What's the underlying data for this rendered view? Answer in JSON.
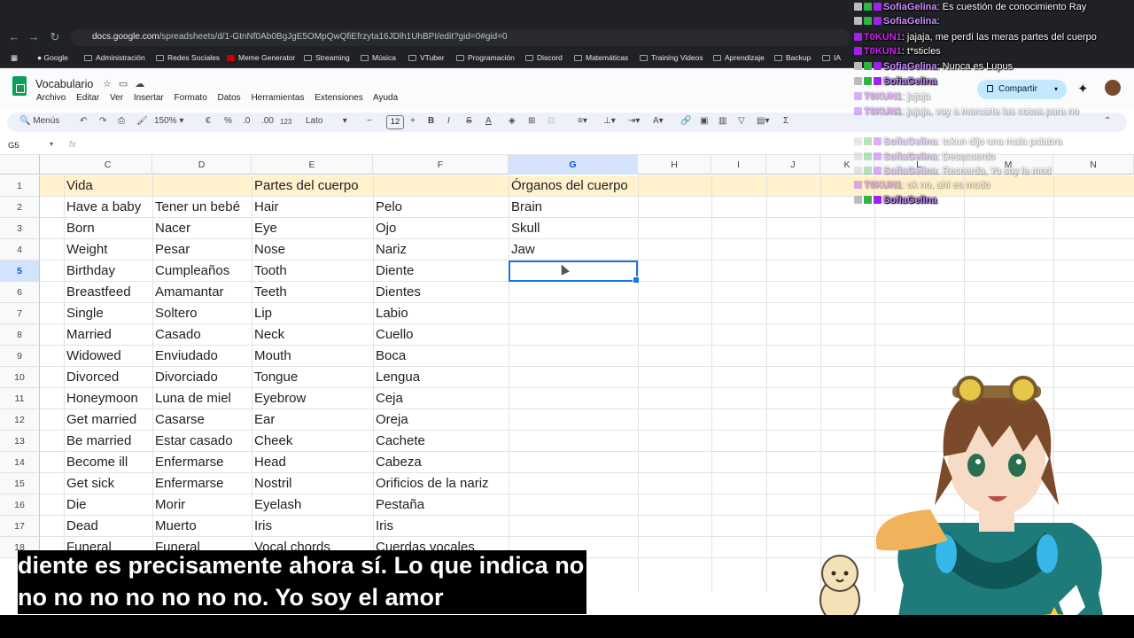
{
  "browser": {
    "url_host": "docs.google.com",
    "url_path": "/spreadsheets/d/1-GtnNf0Ab0BgJgE5OMpQwQfiEfrzyta16JDlh1UhBPI/edit?gid=0#gid=0",
    "bookmarks": [
      "Google",
      "Administración",
      "Redes Sociales",
      "Meme Generator",
      "Streaming",
      "Música",
      "VTuber",
      "Programación",
      "Discord",
      "Matemáticas",
      "Training Videos",
      "Aprendizaje",
      "Backup",
      "IA"
    ]
  },
  "doc": {
    "title": "Vocabulario",
    "menu": [
      "Archivo",
      "Editar",
      "Ver",
      "Insertar",
      "Formato",
      "Datos",
      "Herramientas",
      "Extensiones",
      "Ayuda"
    ],
    "share_label": "Compartir"
  },
  "toolbar": {
    "menus_label": "Menús",
    "zoom": "150%",
    "currency": "€",
    "percent": "%",
    "dec_less": ".0",
    "dec_more": ".00",
    "number_format": "123",
    "font": "Lato",
    "font_size": "12",
    "bold": "B",
    "italic": "I",
    "strike": "S",
    "text_color": "A",
    "sum": "Σ"
  },
  "formula_bar": {
    "name_box": "G5",
    "fx": "fx",
    "value": ""
  },
  "grid": {
    "columns": [
      "C",
      "D",
      "E",
      "F",
      "G",
      "H",
      "I",
      "J",
      "K",
      "L",
      "M",
      "N"
    ],
    "selected_column": "G",
    "row_numbers": [
      "1",
      "2",
      "3",
      "4",
      "5",
      "6",
      "7",
      "8",
      "9",
      "10",
      "11",
      "12",
      "13",
      "14",
      "15",
      "16",
      "17",
      "18"
    ],
    "selected_row": "5",
    "rows": [
      [
        "Vida",
        "",
        "Partes del cuerpo",
        "",
        "Órganos del cuerpo"
      ],
      [
        "Have a baby",
        "Tener un bebé",
        "Hair",
        "Pelo",
        "Brain"
      ],
      [
        "Born",
        "Nacer",
        "Eye",
        "Ojo",
        "Skull"
      ],
      [
        "Weight",
        "Pesar",
        "Nose",
        "Nariz",
        "Jaw"
      ],
      [
        "Birthday",
        "Cumpleaños",
        "Tooth",
        "Diente",
        ""
      ],
      [
        "Breastfeed",
        "Amamantar",
        "Teeth",
        "Dientes",
        ""
      ],
      [
        "Single",
        "Soltero",
        "Lip",
        "Labio",
        ""
      ],
      [
        "Married",
        "Casado",
        "Neck",
        "Cuello",
        ""
      ],
      [
        "Widowed",
        "Enviudado",
        "Mouth",
        "Boca",
        ""
      ],
      [
        "Divorced",
        "Divorciado",
        "Tongue",
        "Lengua",
        ""
      ],
      [
        "Honeymoon",
        "Luna de miel",
        "Eyebrow",
        "Ceja",
        ""
      ],
      [
        "Get married",
        "Casarse",
        "Ear",
        "Oreja",
        ""
      ],
      [
        "Be married",
        "Estar casado",
        "Cheek",
        "Cachete",
        ""
      ],
      [
        "Become ill",
        "Enfermarse",
        "Head",
        "Cabeza",
        ""
      ],
      [
        "Get sick",
        "Enfermarse",
        "Nostril",
        "Orificios de la nariz",
        ""
      ],
      [
        "Die",
        "Morir",
        "Eyelash",
        "Pestaña",
        ""
      ],
      [
        "Dead",
        "Muerto",
        "Iris",
        "Iris",
        ""
      ],
      [
        "Funeral",
        "Funeral",
        "Vocal chords",
        "Cuerdas vocales",
        ""
      ]
    ]
  },
  "chat": [
    {
      "user": "SofiaGelina",
      "msg": ": Es cuestión de conocimiento Ray",
      "faded": false
    },
    {
      "user": "SofiaGelina",
      "msg": ":",
      "faded": false
    },
    {
      "user": "T0KUN1",
      "msg": ": jajaja, me perdí las meras partes del cuerpo",
      "faded": false
    },
    {
      "user": "T0KUN1",
      "msg": ": t*sticles",
      "faded": false
    },
    {
      "user": "SofiaGelina",
      "msg": ": Nunca es Lupus",
      "faded": false
    },
    {
      "user": "SofiaGelina",
      "msg": "",
      "faded": false
    },
    {
      "user": "T0KUN1",
      "msg": ": jajaja",
      "faded": true
    },
    {
      "user": "T0KUN1",
      "msg": ": jajaja, voy a marcarte las cosas para no",
      "faded": true
    },
    {
      "user": "SofiaGelina",
      "msg": ": tokun dijo una mala palabra",
      "faded": true
    },
    {
      "user": "SofiaGelina",
      "msg": ": Desacuerdo",
      "faded": true
    },
    {
      "user": "SofiaGelina",
      "msg": ": Recuerda, Yo soy la mod",
      "faded": true
    },
    {
      "user": "T0KUN1",
      "msg": ": ok no, ahí es modo",
      "faded": true
    },
    {
      "user": "SofiaGelina",
      "msg": "",
      "faded": false
    }
  ],
  "subtitles": {
    "line1": "diente es precisamente ahora sí. Lo que indica no",
    "line2": "no no no no no no no. Yo soy el amor"
  },
  "colors": {
    "header_band": "#fff2cc",
    "selection": "#1a73e8",
    "share_button": "#c2e7ff"
  }
}
